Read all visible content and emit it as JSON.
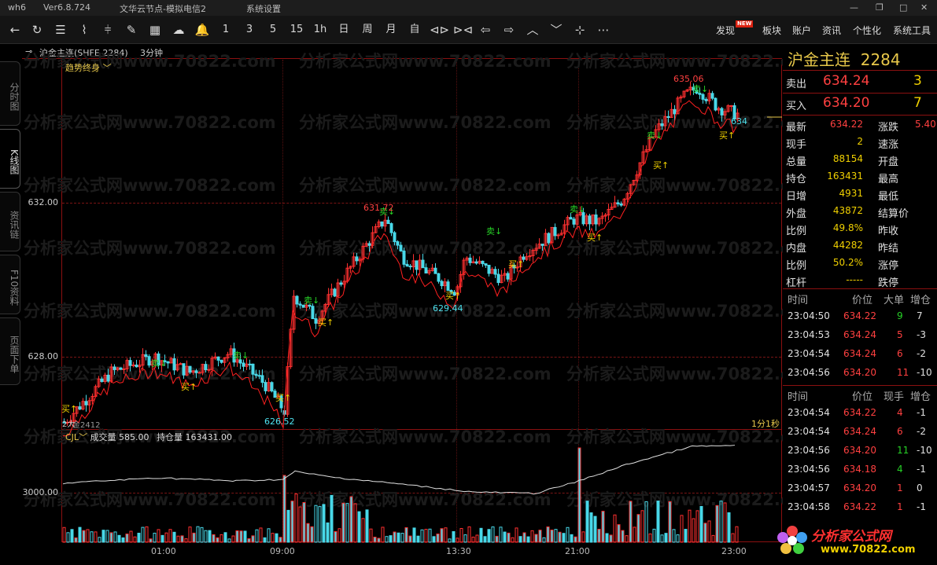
{
  "titlebar": {
    "app": "wh6",
    "version": "Ver6.8.724",
    "server": "文华云节点-模拟电信2",
    "menu": "系统设置"
  },
  "toolbar": {
    "periods": [
      "1",
      "3",
      "5",
      "15",
      "1h",
      "日",
      "周",
      "月",
      "自"
    ],
    "right_menu": [
      "发现",
      "板块",
      "账户",
      "资讯",
      "个性化",
      "系统工具"
    ],
    "new_badge": "NEW"
  },
  "sidetabs": [
    "分时图",
    "K线图",
    "资讯链",
    "F10资料",
    "页面下单"
  ],
  "chart_head": {
    "contract": "沪金主连(SHFE 2284)",
    "period": "3分钟",
    "indicator": "趋势终身",
    "sub_indicator": "CJL",
    "volume_label": "成交量 585.00",
    "oi_label": "持仓量 163431.00",
    "contract_note": "金2412",
    "corner": "1分1秒"
  },
  "y_labels": {
    "p632": "632.00",
    "p628": "628.00",
    "v3000": "3000.00"
  },
  "x_labels": [
    "01:00",
    "09:00",
    "13:30",
    "21:00",
    "23:00"
  ],
  "annotations": {
    "high1": "631.72",
    "low1": "629.44",
    "low2": "626.52",
    "high2": "635.06",
    "last": "634",
    "sell": "卖",
    "buy": "买",
    "hold": "2大"
  },
  "watermark": "分析家公式网www.70822.com",
  "quote": {
    "name": "沪金主连",
    "code": "2284",
    "ask_label": "卖出",
    "ask": "634.24",
    "ask_vol": "3",
    "bid_label": "买入",
    "bid": "634.20",
    "bid_vol": "7",
    "rows": [
      {
        "l": "最新",
        "v": "634.22",
        "l2": "涨跌",
        "v2": "5.40"
      },
      {
        "l": "现手",
        "v": "2",
        "l2": "速涨",
        "v2": ""
      },
      {
        "l": "总量",
        "v": "88154",
        "l2": "开盘",
        "v2": ""
      },
      {
        "l": "持仓",
        "v": "163431",
        "l2": "最高",
        "v2": ""
      },
      {
        "l": "日增",
        "v": "4931",
        "l2": "最低",
        "v2": ""
      },
      {
        "l": "外盘",
        "v": "43872",
        "l2": "结算价",
        "v2": ""
      },
      {
        "l": "比例",
        "v": "49.8%",
        "l2": "昨收",
        "v2": ""
      },
      {
        "l": "内盘",
        "v": "44282",
        "l2": "昨结",
        "v2": ""
      },
      {
        "l": "比例",
        "v": "50.2%",
        "l2": "涨停",
        "v2": ""
      },
      {
        "l": "杠杆",
        "v": "-----",
        "l2": "跌停",
        "v2": ""
      }
    ]
  },
  "big_trades": {
    "headers": [
      "时间",
      "价位",
      "大单",
      "增仓"
    ],
    "rows": [
      [
        "23:04:50",
        "634.22",
        "9",
        "7"
      ],
      [
        "23:04:53",
        "634.24",
        "5",
        "-3"
      ],
      [
        "23:04:54",
        "634.24",
        "6",
        "-2"
      ],
      [
        "23:04:56",
        "634.20",
        "11",
        "-10"
      ]
    ]
  },
  "ticks": {
    "headers": [
      "时间",
      "价位",
      "现手",
      "增仓"
    ],
    "rows": [
      [
        "23:04:54",
        "634.22",
        "4",
        "-1"
      ],
      [
        "23:04:54",
        "634.24",
        "6",
        "-2"
      ],
      [
        "23:04:56",
        "634.20",
        "11",
        "-10"
      ],
      [
        "23:04:56",
        "634.18",
        "4",
        "-1"
      ],
      [
        "23:04:57",
        "634.20",
        "1",
        "0"
      ],
      [
        "23:04:58",
        "634.22",
        "1",
        "-1"
      ]
    ]
  },
  "logo": {
    "text": "分析家公式网",
    "url": "www.70822.com"
  },
  "colors": {
    "up": "#ff3030",
    "down": "#48d8e8",
    "band": "#ff2020",
    "grid": "#7a1414",
    "text": "#cccccc"
  },
  "chart_data": [
    {
      "type": "candlestick",
      "title": "",
      "price_ylim": [
        625.5,
        636.0
      ],
      "y_ticks": [
        628.0,
        632.0
      ],
      "annotated_points": [
        {
          "label": "631.72",
          "value": 631.72
        },
        {
          "label": "629.44",
          "value": 629.44
        },
        {
          "label": "626.52",
          "value": 626.52
        },
        {
          "label": "635.06",
          "value": 635.06
        }
      ],
      "last_price": 634.22
    },
    {
      "type": "bar",
      "title": "",
      "y_ticks": [
        3000.0
      ],
      "series_labels": [
        "成交量",
        "持仓量"
      ]
    }
  ]
}
